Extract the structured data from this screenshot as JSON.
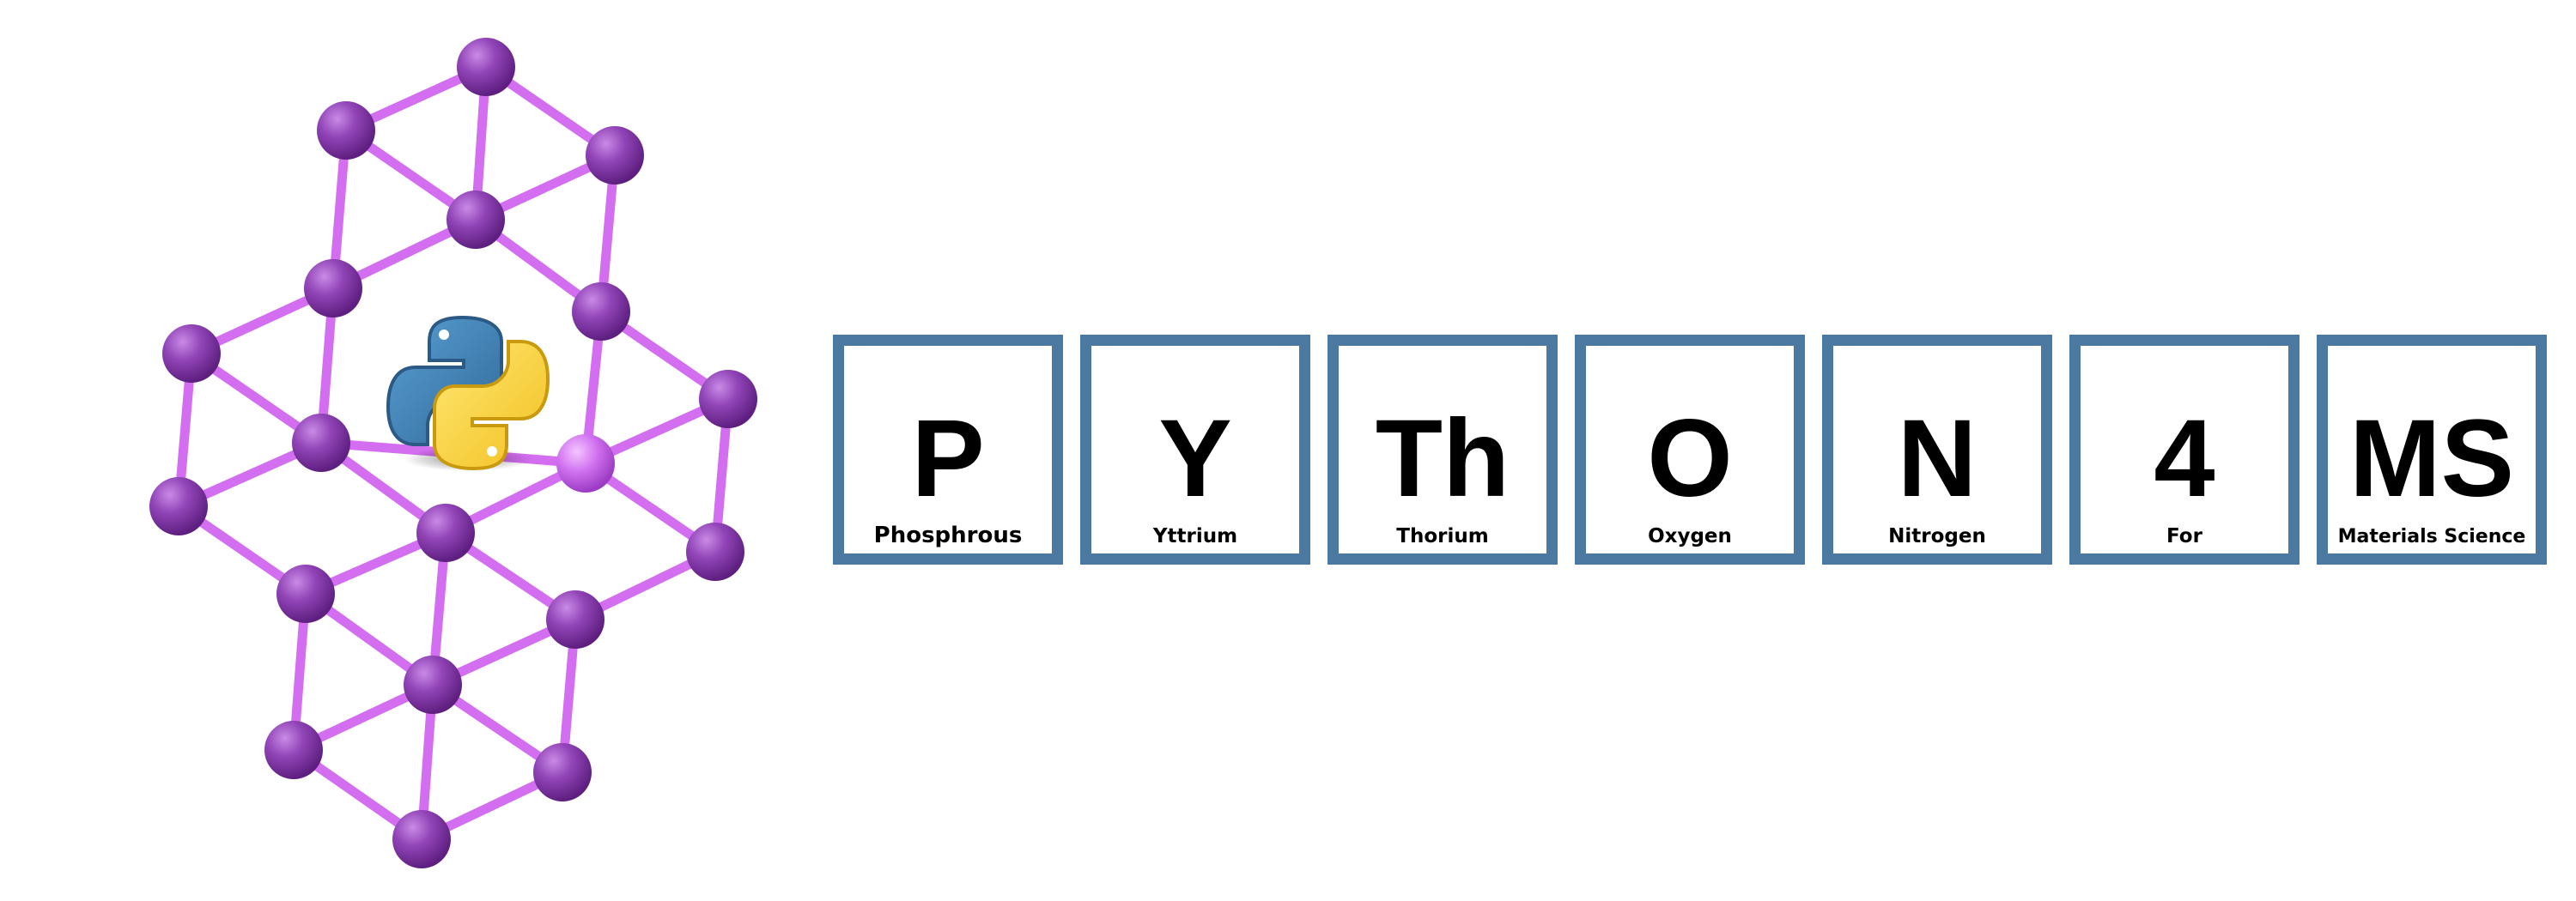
{
  "colors": {
    "tile_border": "#4b79a1",
    "atom": "#8b3fae",
    "bond": "#d46ef0",
    "python_blue": "#3a6f9e",
    "python_yellow": "#f2c832"
  },
  "icons": {
    "lattice": "crystal-lattice-icon",
    "logo": "python-logo-icon"
  },
  "tiles": [
    {
      "symbol": "P",
      "name": "Phosphrous"
    },
    {
      "symbol": "Y",
      "name": "Yttrium"
    },
    {
      "symbol": "Th",
      "name": "Thorium"
    },
    {
      "symbol": "O",
      "name": "Oxygen"
    },
    {
      "symbol": "N",
      "name": "Nitrogen"
    },
    {
      "symbol": "4",
      "name": "For"
    },
    {
      "symbol": "MS",
      "name": "Materials Science"
    }
  ]
}
